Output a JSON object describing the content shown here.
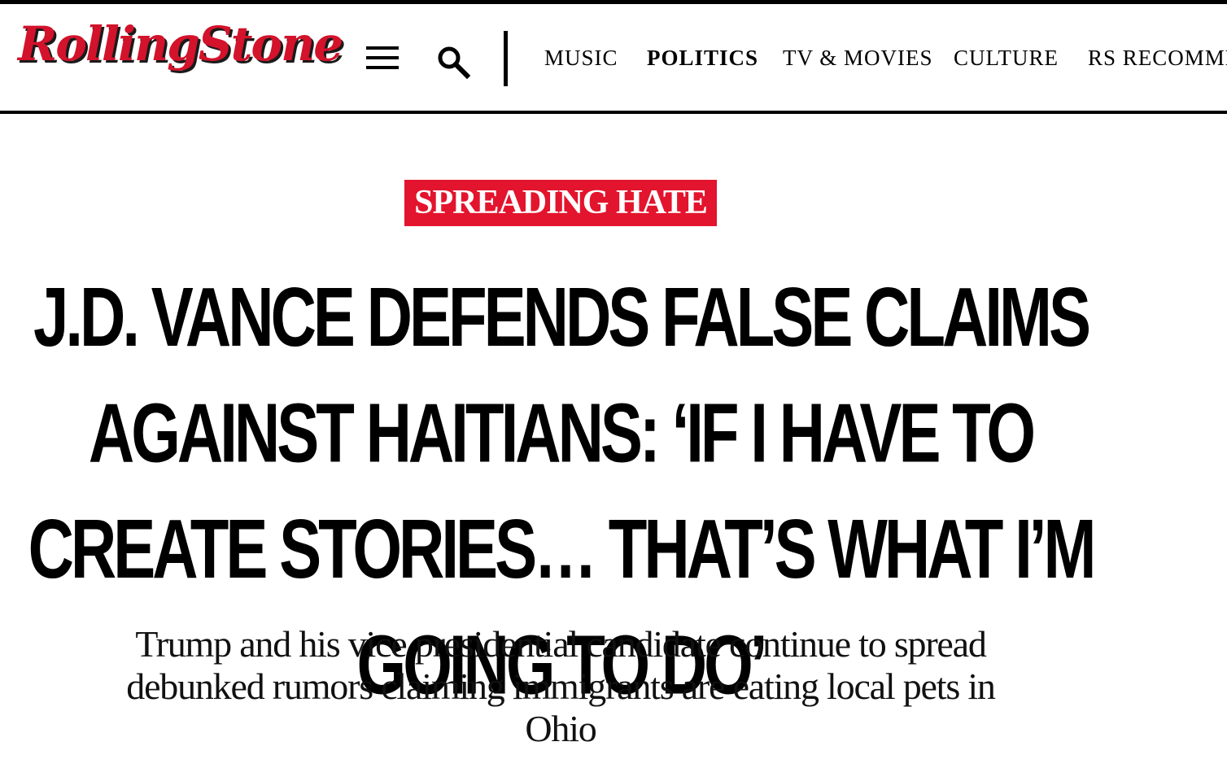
{
  "header": {
    "logo_text": "RollingStone",
    "menu_icon": "hamburger-menu-icon",
    "search_icon": "search-icon",
    "nav": [
      {
        "label": "MUSIC",
        "active": false
      },
      {
        "label": "POLITICS",
        "active": true
      },
      {
        "label": "TV & MOVIES",
        "active": false
      },
      {
        "label": "CULTURE",
        "active": false
      },
      {
        "label": "RS RECOMME",
        "active": false
      }
    ]
  },
  "article": {
    "kicker": "SPREADING HATE",
    "headline": "J.D. Vance Defends False Claims Against Haitians: ‘If I Have to Create Stories… That’s What I’m Going to Do’",
    "dek": "Trump and his vice presidential candidate continue to spread debunked rumors claiming immigrants are eating local pets in Ohio"
  },
  "colors": {
    "brand_red": "#e3142d",
    "text": "#000000",
    "background": "#ffffff"
  }
}
